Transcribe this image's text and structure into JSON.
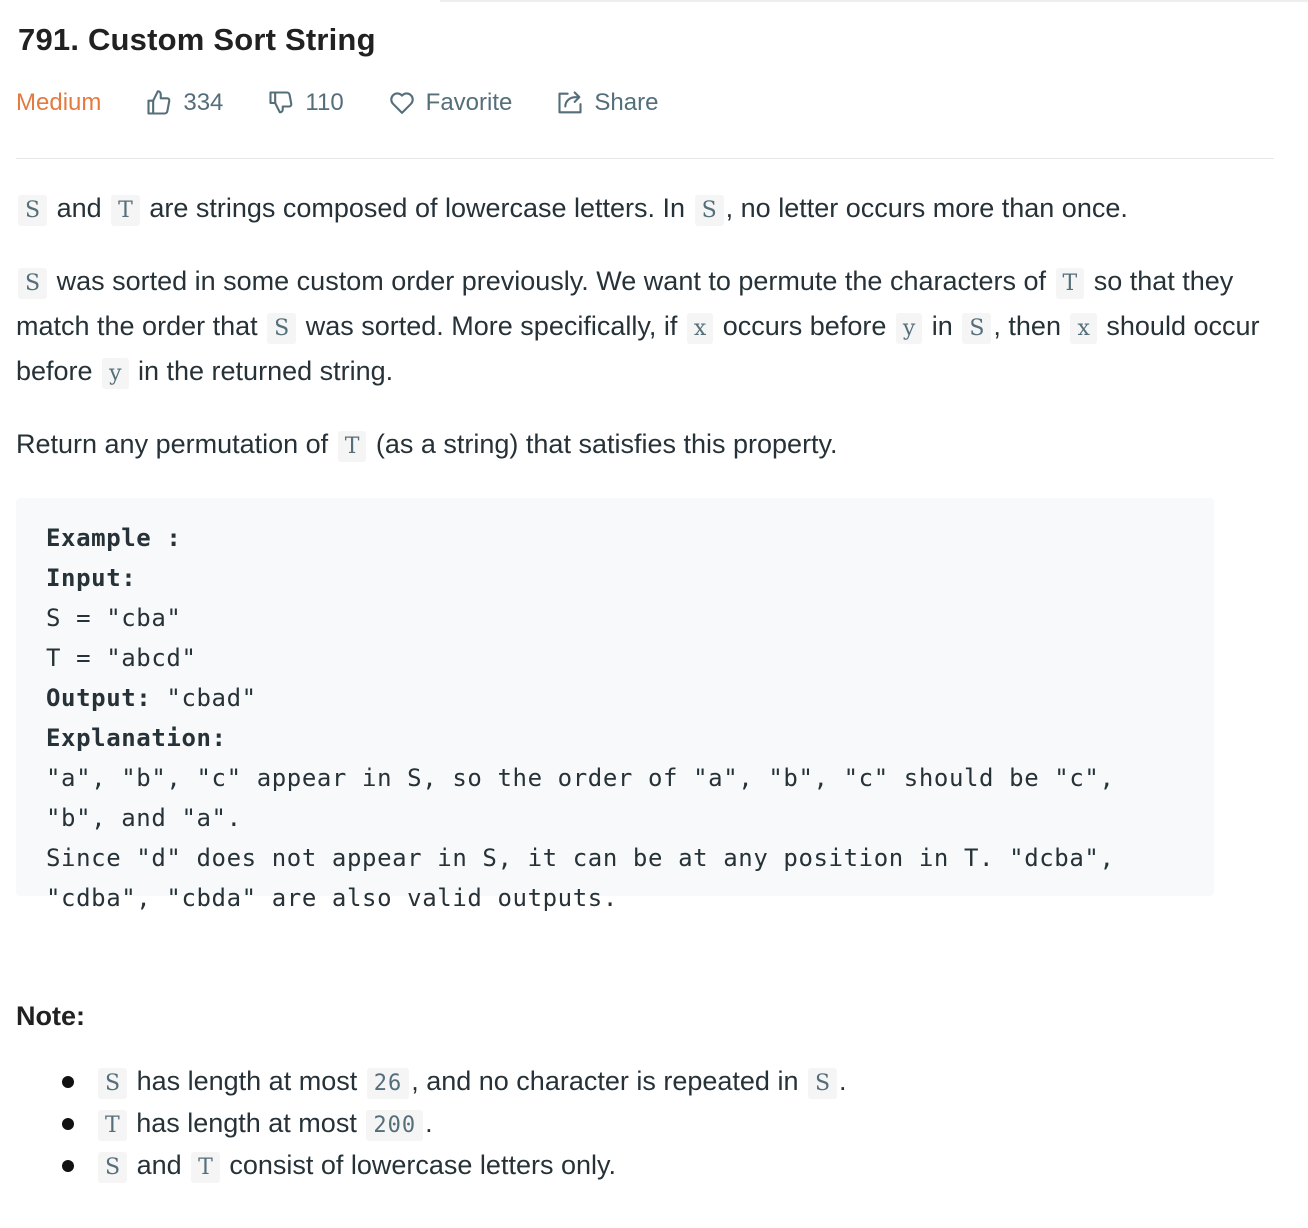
{
  "title": "791. Custom Sort String",
  "meta": {
    "difficulty": "Medium",
    "likes": "334",
    "dislikes": "110",
    "favorite_label": "Favorite",
    "share_label": "Share",
    "difficulty_color": "#e47a3f"
  },
  "description": {
    "p1": {
      "c1": "S",
      "t1": " and ",
      "c2": "T",
      "t2": " are strings composed of lowercase letters. In ",
      "c3": "S",
      "t3": ", no letter occurs more than once."
    },
    "p2": {
      "c1": "S",
      "t1": " was sorted in some custom order previously. We want to permute the characters of ",
      "c2": "T",
      "t2": " so that they match the order that ",
      "c3": "S",
      "t3": " was sorted. More specifically, if ",
      "c4": "x",
      "t4": " occurs before ",
      "c5": "y",
      "t5": " in ",
      "c6": "S",
      "t6": ", then ",
      "c7": "x",
      "t7": " should occur before ",
      "c8": "y",
      "t8": " in the returned string."
    },
    "p3": {
      "t1": "Return any permutation of ",
      "c1": "T",
      "t2": " (as a string) that satisfies this property."
    }
  },
  "example": {
    "heading": "Example :",
    "input_label": "Input:",
    "input_s": "S = \"cba\"",
    "input_t": "T = \"abcd\"",
    "output_label": "Output:",
    "output_value": " \"cbad\"",
    "explanation_label": "Explanation:",
    "explanation_1": "\"a\", \"b\", \"c\" appear in S, so the order of \"a\", \"b\", \"c\" should be \"c\", \"b\", and \"a\".",
    "explanation_2": "Since \"d\" does not appear in S, it can be at any position in T. \"dcba\", \"cdba\", \"cbda\" are also valid outputs."
  },
  "note": {
    "heading": "Note:",
    "items": [
      {
        "c1": "S",
        "t1": " has length at most ",
        "c2": "26",
        "t2": ", and no character is repeated in ",
        "c3": "S",
        "t3": "."
      },
      {
        "c1": "T",
        "t1": " has length at most ",
        "c2": "200",
        "t2": "."
      },
      {
        "c1": "S",
        "t1": " and ",
        "c2": "T",
        "t2": " consist of lowercase letters only."
      }
    ]
  },
  "icons": {
    "like": "thumbs-up-icon",
    "dislike": "thumbs-down-icon",
    "favorite": "heart-icon",
    "share": "share-icon"
  }
}
